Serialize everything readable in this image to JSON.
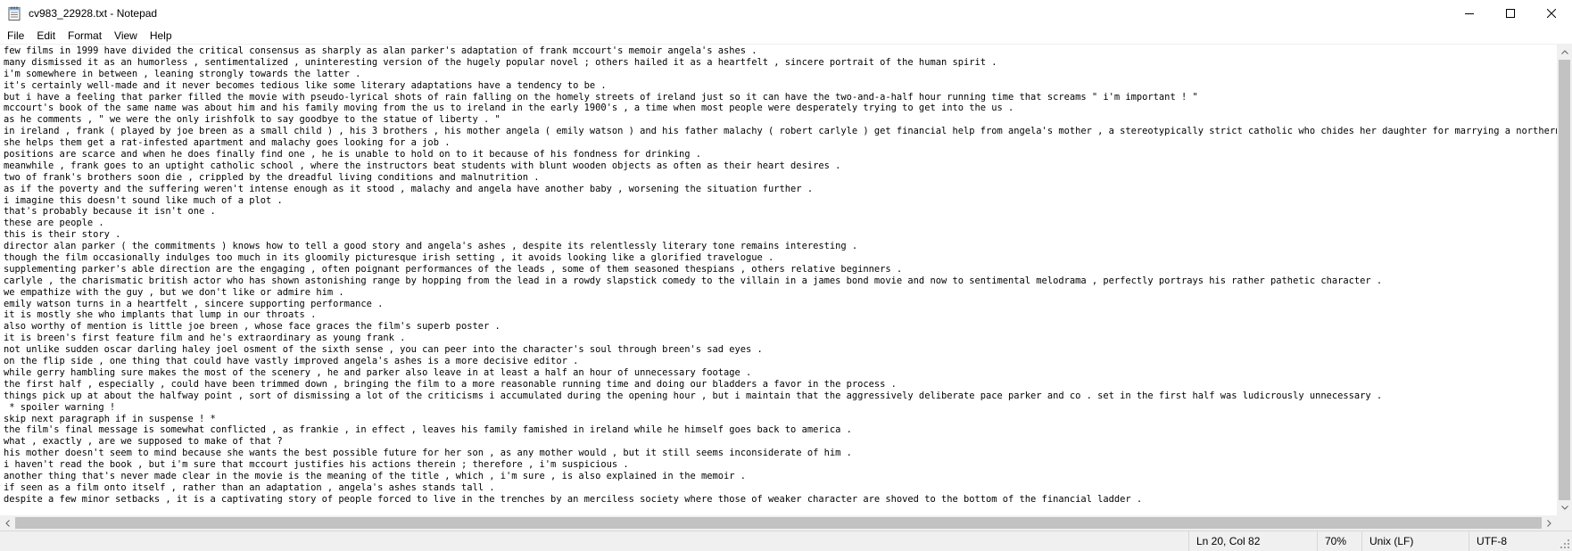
{
  "window": {
    "title": "cv983_22928.txt - Notepad",
    "app_icon": "notepad-icon",
    "controls": [
      "minimize-icon",
      "maximize-icon",
      "close-icon"
    ]
  },
  "menu": {
    "items": [
      "File",
      "Edit",
      "Format",
      "View",
      "Help"
    ]
  },
  "editor": {
    "lines": [
      "few films in 1999 have divided the critical consensus as sharply as alan parker's adaptation of frank mccourt's memoir angela's ashes .",
      "many dismissed it as an humorless , sentimentalized , uninteresting version of the hugely popular novel ; others hailed it as a heartfelt , sincere portrait of the human spirit .",
      "i'm somewhere in between , leaning strongly towards the latter .",
      "it's certainly well-made and it never becomes tedious like some literary adaptations have a tendency to be .",
      "but i have a feeling that parker filled the movie with pseudo-lyrical shots of rain falling on the homely streets of ireland just so it can have the two-and-a-half hour running time that screams \" i'm important ! \"",
      "mccourt's book of the same name was about him and his family moving from the us to ireland in the early 1900's , a time when most people were desperately trying to get into the us .",
      "as he comments , \" we were the only irishfolk to say goodbye to the statue of liberty . \"",
      "in ireland , frank ( played by joe breen as a small child ) , his 3 brothers , his mother angela ( emily watson ) and his father malachy ( robert carlyle ) get financial help from angela's mother , a stereotypically strict catholic who chides her daughter for marrying a northern irishman .",
      "she helps them get a rat-infested apartment and malachy goes looking for a job .",
      "positions are scarce and when he does finally find one , he is unable to hold on to it because of his fondness for drinking .",
      "meanwhile , frank goes to an uptight catholic school , where the instructors beat students with blunt wooden objects as often as their heart desires .",
      "two of frank's brothers soon die , crippled by the dreadful living conditions and malnutrition .",
      "as if the poverty and the suffering weren't intense enough as it stood , malachy and angela have another baby , worsening the situation further .",
      "i imagine this doesn't sound like much of a plot .",
      "that's probably because it isn't one .",
      "these are people .",
      "this is their story .",
      "director alan parker ( the commitments ) knows how to tell a good story and angela's ashes , despite its relentlessly literary tone remains interesting .",
      "though the film occasionally indulges too much in its gloomily picturesque irish setting , it avoids looking like a glorified travelogue .",
      "supplementing parker's able direction are the engaging , often poignant performances of the leads , some of them seasoned thespians , others relative beginners .",
      "carlyle , the charismatic british actor who has shown astonishing range by hopping from the lead in a rowdy slapstick comedy to the villain in a james bond movie and now to sentimental melodrama , perfectly portrays his rather pathetic character .",
      "we empathize with the guy , but we don't like or admire him .",
      "emily watson turns in a heartfelt , sincere supporting performance .",
      "it is mostly she who implants that lump in our throats .",
      "also worthy of mention is little joe breen , whose face graces the film's superb poster .",
      "it is breen's first feature film and he's extraordinary as young frank .",
      "not unlike sudden oscar darling haley joel osment of the sixth sense , you can peer into the character's soul through breen's sad eyes .",
      "on the flip side , one thing that could have vastly improved angela's ashes is a more decisive editor .",
      "while gerry hambling sure makes the most of the scenery , he and parker also leave in at least a half an hour of unnecessary footage .",
      "the first half , especially , could have been trimmed down , bringing the film to a more reasonable running time and doing our bladders a favor in the process .",
      "things pick up at about the halfway point , sort of dismissing a lot of the criticisms i accumulated during the opening hour , but i maintain that the aggressively deliberate pace parker and co . set in the first half was ludicrously unnecessary .",
      " * spoiler warning !",
      "skip next paragraph if in suspense ! *",
      "the film's final message is somewhat conflicted , as frankie , in effect , leaves his family famished in ireland while he himself goes back to america .",
      "what , exactly , are we supposed to make of that ?",
      "his mother doesn't seem to mind because she wants the best possible future for her son , as any mother would , but it still seems inconsiderate of him .",
      "i haven't read the book , but i'm sure that mccourt justifies his actions therein ; therefore , i'm suspicious .",
      "another thing that's never made clear in the movie is the meaning of the title , which , i'm sure , is also explained in the memoir .",
      "if seen as a film onto itself , rather than an adaptation , angela's ashes stands tall .",
      "despite a few minor setbacks , it is a captivating story of people forced to live in the trenches by an merciless society where those of weaker character are shoved to the bottom of the financial ladder ."
    ]
  },
  "statusbar": {
    "position": "Ln 20, Col 82",
    "zoom": "70%",
    "line_ending": "Unix (LF)",
    "encoding": "UTF-8"
  },
  "colors": {
    "titlebar_bg": "#ffffff",
    "statusbar_bg": "#f0f0f0",
    "scrollbar_thumb": "#c2c2c2",
    "text": "#000000"
  }
}
